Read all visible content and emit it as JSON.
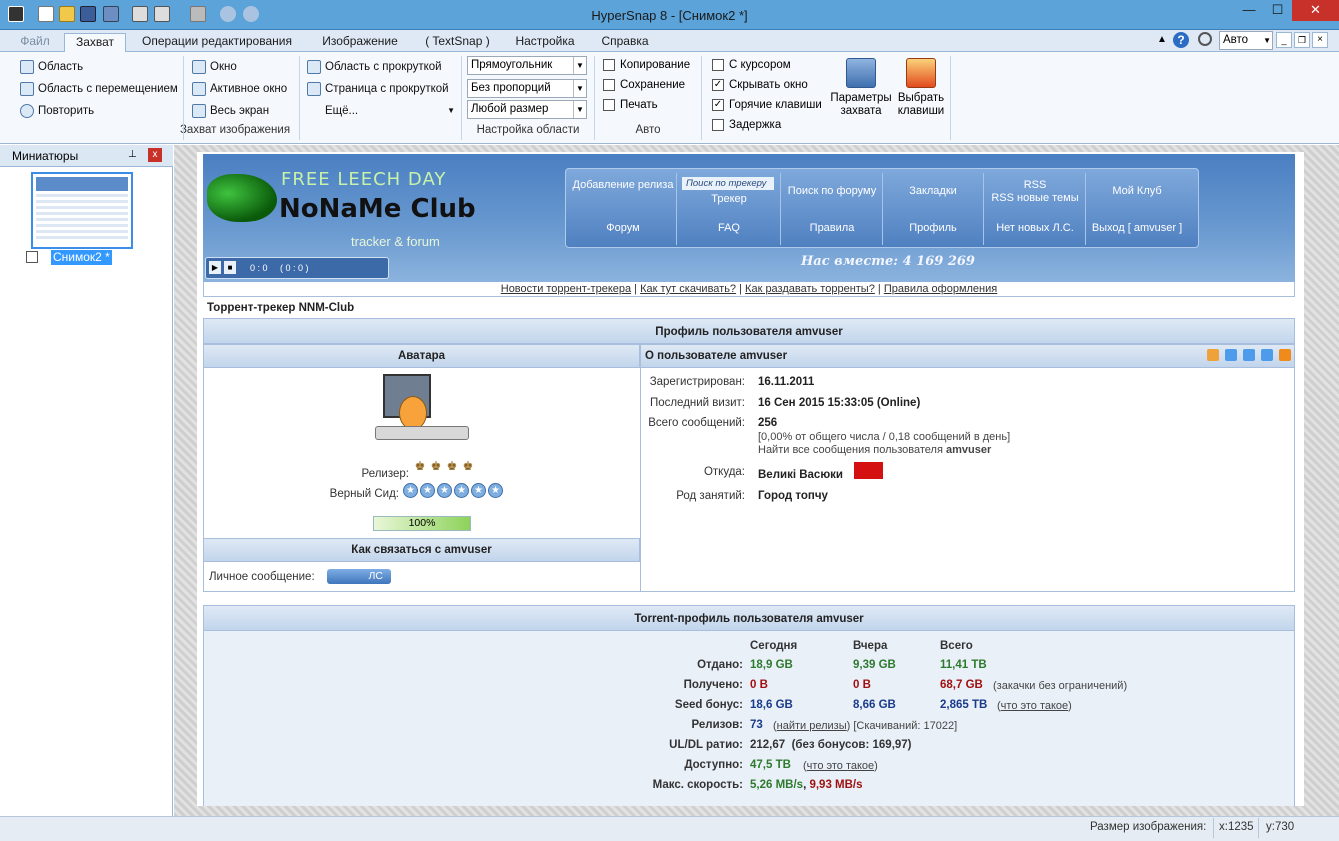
{
  "window": {
    "title": "HyperSnap 8 - [Снимок2 *]",
    "minimize": "—",
    "maximize": "☐",
    "close": "✕"
  },
  "tabs": [
    "Файл",
    "Захват",
    "Операции редактирования",
    "Изображение",
    "( TextSnap )",
    "Настройка",
    "Справка"
  ],
  "zoom_select": "Авто",
  "ribbon": {
    "capture_col1": [
      "Область",
      "Область с перемещением",
      "Повторить"
    ],
    "capture_col2": [
      "Окно",
      "Активное окно",
      "Весь экран"
    ],
    "capture_col3": [
      "Область с прокруткой",
      "Страница с прокруткой",
      "Ещё..."
    ],
    "group_capture": "Захват изображения",
    "area_dropdowns": [
      "Прямоугольник",
      "Без пропорций",
      "Любой размер"
    ],
    "group_area": "Настройка области",
    "auto_checks": [
      "Копирование",
      "Сохранение",
      "Печать"
    ],
    "group_auto": "Авто",
    "options": [
      {
        "label": "С курсором",
        "checked": false
      },
      {
        "label": "Скрывать окно",
        "checked": true
      },
      {
        "label": "Горячие клавиши",
        "checked": true
      },
      {
        "label": "Задержка",
        "checked": false
      }
    ],
    "btn_params": "Параметры захвата",
    "btn_hotkeys": "Выбрать клавиши"
  },
  "left_panel": {
    "title": "Миниатюры",
    "pin": "📌",
    "close": "x",
    "thumb_label": "Снимок2 *"
  },
  "status": {
    "size_label": "Размер изображения:",
    "x": "x:1235",
    "y": "y:730"
  },
  "site": {
    "logo_top": "FREE LEECH DAY",
    "logo_main": "NoNaMe Club",
    "logo_sub": "tracker & forum",
    "player_time": "0 : 0     ( 0 : 0 )",
    "nav_row1": [
      "Добавление релиза",
      "Поиск по трекеру",
      "Поиск по форуму",
      "Закладки",
      "RSS\nRSS новые темы",
      "Мой Клуб"
    ],
    "nav_tracker": "Трекер",
    "nav_row2": [
      "Форум",
      "FAQ",
      "Правила",
      "Профиль",
      "Нет новых Л.С.",
      "Выход [ amvuser ]"
    ],
    "together": "Нас вместе: 4 169 269",
    "links": [
      "Новости торрент-трекера",
      "Как тут скачивать?",
      "Как раздавать торренты?",
      "Правила оформления"
    ],
    "breadcrumb": "Торрент-трекер NNM-Club",
    "profile_header": "Профиль пользователя amvuser",
    "avatar_header": "Аватара",
    "about_header": "О пользователе amvuser",
    "releaser_label": "Релизер:",
    "seed_label": "Верный Сид:",
    "progress": "100%",
    "contact_header": "Как связаться с amvuser",
    "pm_label": "Личное сообщение:",
    "pm_button": "ЛС",
    "registered_label": "Зарегистрирован:",
    "registered": "16.11.2011",
    "last_visit_label": "Последний визит:",
    "last_visit": "16 Сен 2015 15:33:05 (Online)",
    "posts_label": "Всего сообщений:",
    "posts": "256",
    "posts_note": "[0,00% от общего числа / 0,18 сообщений в день]",
    "posts_find": "Найти все сообщения пользователя ",
    "posts_find_user": "amvuser",
    "from_label": "Откуда:",
    "from": "Великі Васюки",
    "occ_label": "Род занятий:",
    "occ": "Город топчу",
    "torrent_header": "Torrent-профиль пользователя amvuser",
    "cols": [
      "Сегодня",
      "Вчера",
      "Всего"
    ],
    "given_label": "Отдано:",
    "given": [
      "18,9 GB",
      "9,39 GB",
      "11,41 TB"
    ],
    "got_label": "Получено:",
    "got": [
      "0 B",
      "0 B",
      "68,7 GB"
    ],
    "got_note": "(закачки без ограничений)",
    "seed_bonus_label": "Seed бонус:",
    "seed_bonus": [
      "18,6 GB",
      "8,66 GB",
      "2,865 TB"
    ],
    "what_is": "что это такое",
    "releases_label": "Релизов:",
    "releases": "73",
    "find_releases": "найти релизы",
    "downloads": "[Скачиваний: 17022]",
    "ratio_label": "UL/DL ратио:",
    "ratio": "212,67  (без бонусов: 169,97)",
    "avail_label": "Доступно:",
    "avail": "47,5 TB",
    "speed_label": "Макс. скорость:",
    "speed_up": "5,26 MB/s",
    "speed_down": "9,93 MB/s"
  }
}
